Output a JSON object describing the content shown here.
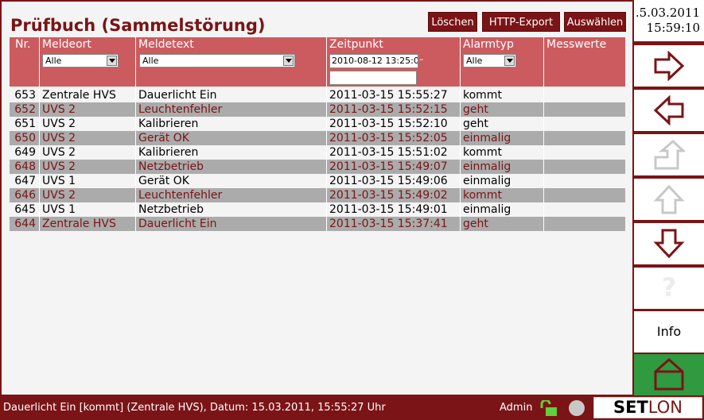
{
  "title": "Prüfbuch (Sammelstörung)",
  "toolbar": {
    "delete_label": "Löschen",
    "export_label": "HTTP-Export",
    "select_label": "Auswählen"
  },
  "table": {
    "columns": [
      "Nr.",
      "Meldeort",
      "Meldetext",
      "Zeitpunkt",
      "Alarmtyp",
      "Messwerte"
    ],
    "filters": {
      "meldeort": "Alle",
      "meldetext": "Alle",
      "zeitpunkt_from": "2010-08-12 13:25:0",
      "zeitpunkt_sep": "–",
      "zeitpunkt_to": "",
      "alarmtyp": "Alle"
    },
    "rows": [
      {
        "nr": "653",
        "ort": "Zentrale HVS",
        "text": "Dauerlicht Ein",
        "zeit": "2011-03-15 15:55:27",
        "typ": "kommt",
        "mess": ""
      },
      {
        "nr": "652",
        "ort": "UVS 2",
        "text": "Leuchtenfehler",
        "zeit": "2011-03-15 15:52:15",
        "typ": "geht",
        "mess": ""
      },
      {
        "nr": "651",
        "ort": "UVS 2",
        "text": "Kalibrieren",
        "zeit": "2011-03-15 15:52:10",
        "typ": "geht",
        "mess": ""
      },
      {
        "nr": "650",
        "ort": "UVS 2",
        "text": "Gerät OK",
        "zeit": "2011-03-15 15:52:05",
        "typ": "einmalig",
        "mess": ""
      },
      {
        "nr": "649",
        "ort": "UVS 2",
        "text": "Kalibrieren",
        "zeit": "2011-03-15 15:51:02",
        "typ": "kommt",
        "mess": ""
      },
      {
        "nr": "648",
        "ort": "UVS 2",
        "text": "Netzbetrieb",
        "zeit": "2011-03-15 15:49:07",
        "typ": "einmalig",
        "mess": ""
      },
      {
        "nr": "647",
        "ort": "UVS 1",
        "text": "Gerät OK",
        "zeit": "2011-03-15 15:49:06",
        "typ": "einmalig",
        "mess": ""
      },
      {
        "nr": "646",
        "ort": "UVS 2",
        "text": "Leuchtenfehler",
        "zeit": "2011-03-15 15:49:02",
        "typ": "kommt",
        "mess": ""
      },
      {
        "nr": "645",
        "ort": "UVS 1",
        "text": "Netzbetrieb",
        "zeit": "2011-03-15 15:49:01",
        "typ": "einmalig",
        "mess": ""
      },
      {
        "nr": "644",
        "ort": "Zentrale HVS",
        "text": "Dauerlicht Ein",
        "zeit": "2011-03-15 15:37:41",
        "typ": "geht",
        "mess": ""
      }
    ]
  },
  "sidebar": {
    "date": ".5.03.2011",
    "time": "15:59:10",
    "help_label": "?",
    "info_label": "Info",
    "icons": [
      "arrow-right-icon",
      "arrow-left-icon",
      "arrow-up-turn-icon",
      "arrow-up-icon",
      "arrow-down-icon",
      "question-icon",
      "home-icon"
    ]
  },
  "status": {
    "message": "Dauerlicht Ein [kommt] (Zentrale HVS), Datum: 15.03.2011, 15:55:27 Uhr",
    "user": "Admin",
    "logo_left": "SET",
    "logo_right": "LON"
  },
  "colors": {
    "brand": "#7a1416",
    "header": "#cc5b5f",
    "row_alt": "#ababab",
    "home": "#2f9a3f"
  }
}
